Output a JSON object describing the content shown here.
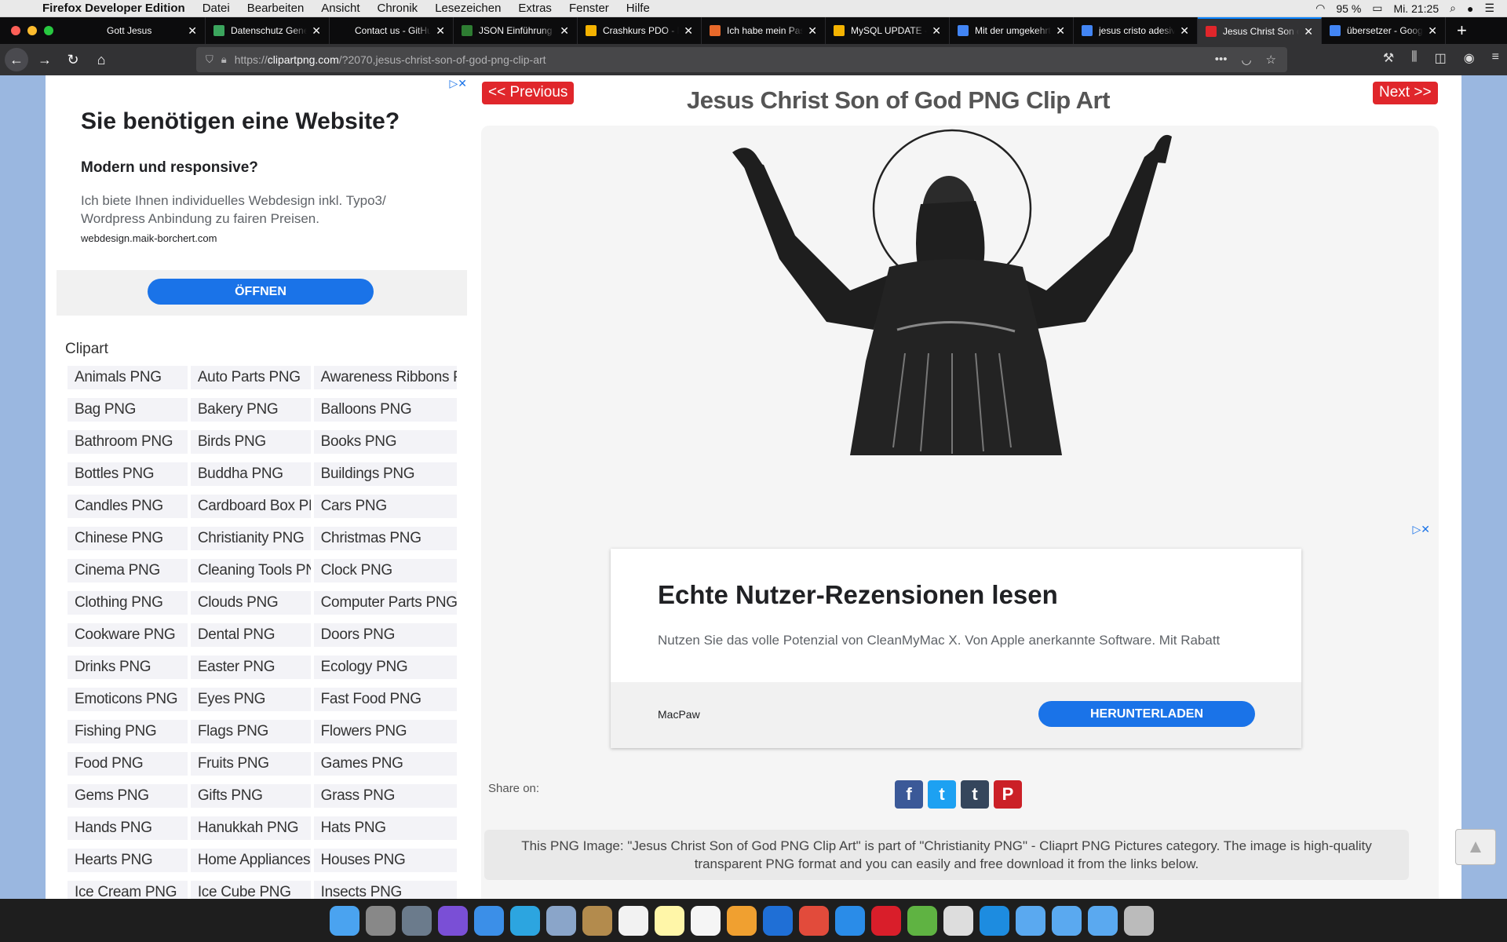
{
  "menubar": {
    "app": "Firefox Developer Edition",
    "items": [
      "Datei",
      "Bearbeiten",
      "Ansicht",
      "Chronik",
      "Lesezeichen",
      "Extras",
      "Fenster",
      "Hilfe"
    ],
    "battery": "95 %",
    "clock": "Mi. 21:25"
  },
  "tabs": [
    {
      "label": "Gott Jesus",
      "favicon_color": "#0c0c0d"
    },
    {
      "label": "Datenschutz Generator",
      "favicon_color": "#3ba55d"
    },
    {
      "label": "Contact us - GitHub",
      "favicon_color": "#0c0c0d"
    },
    {
      "label": "JSON Einführung",
      "favicon_color": "#2e7d32"
    },
    {
      "label": "Crashkurs PDO - Mitarbeiter",
      "favicon_color": "#f5b301"
    },
    {
      "label": "Ich habe mein Passwort",
      "favicon_color": "#e8692a"
    },
    {
      "label": "MySQL UPDATE - Datensätze",
      "favicon_color": "#f5b301"
    },
    {
      "label": "Mit der umgekehrten Bildersuche",
      "favicon_color": "#4285f4"
    },
    {
      "label": "jesus cristo adesivo",
      "favicon_color": "#4285f4"
    },
    {
      "label": "Jesus Christ Son of God",
      "favicon_color": "#e0262b",
      "active": true
    },
    {
      "label": "übersetzer - Google Suche",
      "favicon_color": "#4285f4"
    }
  ],
  "navbar": {
    "url_prefix": "https://",
    "url_host": "clipartpng.com",
    "url_path": "/?2070,jesus-christ-son-of-god-png-clip-art"
  },
  "ad_top": {
    "headline": "Sie benötigen eine Website?",
    "subheadline": "Modern und responsive?",
    "body": "Ich biete Ihnen individuelles Webdesign inkl. Typo3/ Wordpress Anbindung zu fairen Preisen.",
    "domain": "webdesign.maik-borchert.com",
    "button": "ÖFFNEN"
  },
  "clipart": {
    "heading": "Clipart",
    "categories": [
      [
        "Animals PNG",
        "Auto Parts PNG",
        "Awareness Ribbons PNG"
      ],
      [
        "Bag PNG",
        "Bakery PNG",
        "Balloons PNG"
      ],
      [
        "Bathroom PNG",
        "Birds PNG",
        "Books PNG"
      ],
      [
        "Bottles PNG",
        "Buddha PNG",
        "Buildings PNG"
      ],
      [
        "Candles PNG",
        "Cardboard Box PNG",
        "Cars PNG"
      ],
      [
        "Chinese PNG",
        "Christianity PNG",
        "Christmas PNG"
      ],
      [
        "Cinema PNG",
        "Cleaning Tools PNG",
        "Clock PNG"
      ],
      [
        "Clothing PNG",
        "Clouds PNG",
        "Computer Parts PNG"
      ],
      [
        "Cookware PNG",
        "Dental PNG",
        "Doors PNG"
      ],
      [
        "Drinks PNG",
        "Easter PNG",
        "Ecology PNG"
      ],
      [
        "Emoticons PNG",
        "Eyes PNG",
        "Fast Food PNG"
      ],
      [
        "Fishing PNG",
        "Flags PNG",
        "Flowers PNG"
      ],
      [
        "Food PNG",
        "Fruits PNG",
        "Games PNG"
      ],
      [
        "Gems PNG",
        "Gifts PNG",
        "Grass PNG"
      ],
      [
        "Hands PNG",
        "Hanukkah PNG",
        "Hats PNG"
      ],
      [
        "Hearts PNG",
        "Home Appliances PNG",
        "Houses PNG"
      ],
      [
        "Ice Cream PNG",
        "Ice Cube PNG",
        "Insects PNG"
      ]
    ]
  },
  "main": {
    "prev": "<< Previous",
    "next": "Next >>",
    "title": "Jesus Christ Son of God PNG Clip Art"
  },
  "ad_bottom": {
    "headline": "Echte Nutzer-Rezensionen lesen",
    "body": "Nutzen Sie das volle Potenzial von CleanMyMac X. Von Apple anerkannte Software. Mit Rabatt",
    "brand": "MacPaw",
    "button": "HERUNTERLADEN"
  },
  "share": {
    "label": "Share on:",
    "icons": [
      "facebook-icon",
      "twitter-icon",
      "tumblr-icon",
      "pinterest-icon"
    ]
  },
  "description": "This PNG Image: \"Jesus Christ Son of God PNG Clip Art\" is part of \"Christianity PNG\" - Cliaprt PNG Pictures category. The image is high-quality transparent PNG format and you can easily and free download it from the links below.",
  "colors": {
    "accent_red": "#e0262b",
    "ad_blue": "#1a73e8",
    "tab_active_border": "#0a84ff"
  }
}
